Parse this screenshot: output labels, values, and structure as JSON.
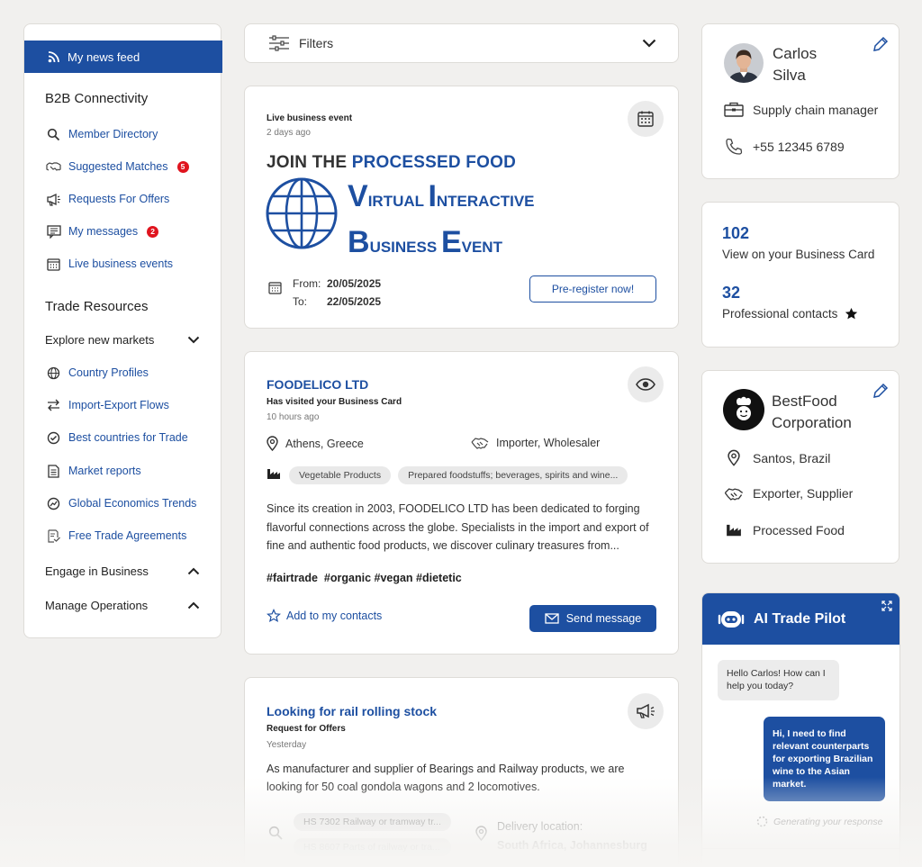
{
  "sidebar": {
    "feed_label": "My news feed",
    "b2b_heading": "B2B Connectivity",
    "b2b_items": [
      {
        "label": "Member Directory",
        "icon": "search-icon"
      },
      {
        "label": "Suggested Matches",
        "icon": "handshake-icon",
        "badge": "5"
      },
      {
        "label": "Requests For Offers",
        "icon": "megaphone-icon"
      },
      {
        "label": "My messages",
        "icon": "message-icon",
        "badge": "2"
      },
      {
        "label": "Live business events",
        "icon": "calendar-icon"
      }
    ],
    "trade_heading": "Trade Resources",
    "explore_label": "Explore new markets",
    "trade_items": [
      {
        "label": "Country Profiles",
        "icon": "globe-icon"
      },
      {
        "label": "Import-Export Flows",
        "icon": "arrows-icon"
      },
      {
        "label": "Best countries for Trade",
        "icon": "check-circle-icon"
      },
      {
        "label": "Market reports",
        "icon": "document-icon"
      },
      {
        "label": "Global Economics Trends",
        "icon": "trend-icon"
      },
      {
        "label": "Free Trade Agreements",
        "icon": "agreement-icon"
      }
    ],
    "engage_label": "Engage in Business",
    "manage_label": "Manage Operations"
  },
  "filters": {
    "label": "Filters"
  },
  "event_post": {
    "type": "Live business event",
    "time": "2 days ago",
    "join_prefix": "JOIN THE",
    "join_highlight": "PROCESSED FOOD",
    "line1_initial_v": "V",
    "line1_rest_v": "IRTUAL",
    "line1_initial_i": "I",
    "line1_rest_i": "NTERACTIVE",
    "line2_initial_b": "B",
    "line2_rest_b": "USINESS",
    "line2_initial_e": "E",
    "line2_rest_e": "VENT",
    "from_label": "From:",
    "from_date": "20/05/2025",
    "to_label": "To:",
    "to_date": "22/05/2025",
    "register_label": "Pre-register now!"
  },
  "company_post": {
    "name": "FOODELICO LTD",
    "type": "Has visited your Business Card",
    "time": "10 hours ago",
    "location": "Athens, Greece",
    "role": "Importer, Wholesaler",
    "chips": [
      "Vegetable Products",
      "Prepared foodstuffs; beverages, spirits and wine..."
    ],
    "description": "Since its creation in 2003, FOODELICO LTD has been dedicated to forging flavorful connections across the globe. Specialists in the import and export of fine and authentic food products, we discover culinary treasures from...",
    "hashtags": "#fairtrade  #organic #vegan #dietetic",
    "add_contact_label": "Add to my contacts",
    "send_message_label": "Send message"
  },
  "rfo_post": {
    "title": "Looking for rail rolling stock",
    "type": "Request for Offers",
    "time": "Yesterday",
    "description": "As manufacturer and supplier of Bearings and Railway products, we are looking for 50 coal gondola wagons and 2 locomotives.",
    "hs_chips": [
      "HS 7302 Railway or tramway tr...",
      "HS 8607 Parts of railway or tra..."
    ],
    "delivery_label": "Delivery location:",
    "delivery_value": "South Africa, Johannesburg"
  },
  "profile": {
    "first_name": "Carlos",
    "last_name": "Silva",
    "job": "Supply chain manager",
    "phone": "+55 12345 6789"
  },
  "stats": {
    "views_count": "102",
    "views_label": "View on your Business Card",
    "contacts_count": "32",
    "contacts_label": "Professional contacts"
  },
  "company_card": {
    "name_line1": "BestFood",
    "name_line2": "Corporation",
    "location": "Santos, Brazil",
    "role": "Exporter, Supplier",
    "sector": "Processed Food"
  },
  "ai": {
    "title": "AI Trade Pilot",
    "bot_message": "Hello Carlos! How can I help you today?",
    "user_message": "Hi, I need to find relevant counterparts for exporting Brazilian wine to the Asian market.",
    "status": "Generating your response"
  },
  "colors": {
    "accent": "#1d4fa1",
    "badge": "#e0141e",
    "background": "#f1f0ee"
  }
}
